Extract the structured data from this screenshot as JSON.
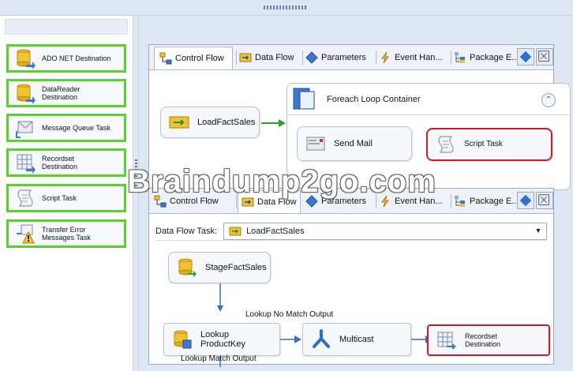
{
  "toolbox": {
    "items": [
      {
        "label": "ADO NET Destination",
        "icon": "ado-net-destination-icon"
      },
      {
        "label": "DataReader\nDestination",
        "icon": "datareader-destination-icon"
      },
      {
        "label": "Message Queue Task",
        "icon": "message-queue-icon"
      },
      {
        "label": "Recordset\nDestination",
        "icon": "recordset-destination-icon"
      },
      {
        "label": "Script Task",
        "icon": "script-task-icon"
      },
      {
        "label": "Transfer Error\nMessages Task",
        "icon": "transfer-error-icon"
      }
    ],
    "highlight_color": "#5bd12e"
  },
  "tabs": {
    "control_flow": "Control Flow",
    "data_flow": "Data Flow",
    "parameters": "Parameters",
    "event_handlers": "Event Han...",
    "package_explorer": "Package E..."
  },
  "tabs2": {
    "control_flow": "Control Flow",
    "data_flow": "Data Flow",
    "parameters": "Parameters",
    "event_handlers": "Event Han...",
    "package_explorer": "Package E..."
  },
  "control_flow": {
    "load_fact_sales": "LoadFactSales",
    "container_label": "Foreach Loop Container",
    "send_mail": "Send Mail",
    "script_task": "Script Task"
  },
  "data_flow": {
    "task_label": "Data Flow Task:",
    "task_value": "LoadFactSales",
    "stage_fact_sales": "StageFactSales",
    "lookup_no_match": "Lookup No Match Output",
    "lookup_product_key": "Lookup\nProductKey",
    "multicast": "Multicast",
    "recordset_destination": "Recordset\nDestination",
    "lookup_match": "Lookup Match Output"
  },
  "watermark": "Braindump2go.com",
  "colors": {
    "selection_red": "#c81e26",
    "accent_blue": "#2f6fcf"
  }
}
